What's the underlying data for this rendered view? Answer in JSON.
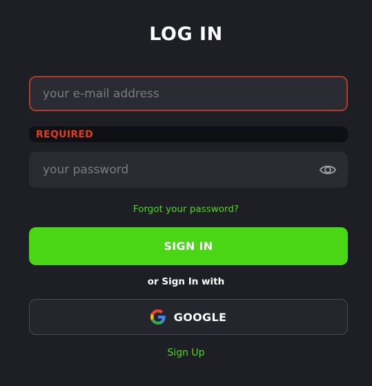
{
  "title": "LOG IN",
  "email": {
    "placeholder": "your e-mail address",
    "value": ""
  },
  "required_label": "REQUIRED",
  "password": {
    "placeholder": "your password",
    "value": "",
    "toggle_icon": "eye-icon"
  },
  "forgot_link": "Forgot your password?",
  "signin_button": "SIGN IN",
  "alt_signin_text": "or Sign In with",
  "google_button": {
    "label": "GOOGLE",
    "icon": "google-logo-icon"
  },
  "signup_link": "Sign Up",
  "colors": {
    "background": "#1e1f24",
    "field_background": "#2a2b33",
    "error_border": "#b33a2c",
    "error_text": "#e03b24",
    "accent_green": "#4ad615",
    "link_green": "#4ed81d"
  }
}
